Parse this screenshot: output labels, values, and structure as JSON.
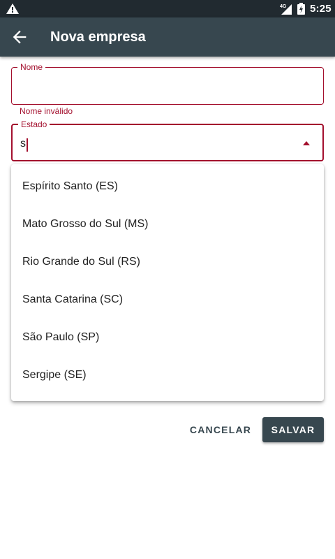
{
  "status_bar": {
    "time": "5:25",
    "network_label": "4G",
    "icons": [
      "warning-icon",
      "signal-4g-icon",
      "battery-charging-icon"
    ]
  },
  "app_bar": {
    "title": "Nova empresa",
    "back_icon": "arrow-back-icon"
  },
  "form": {
    "nome": {
      "label": "Nome",
      "value": "",
      "error": "Nome inválido"
    },
    "estado": {
      "label": "Estado",
      "value": "s",
      "dropdown_icon": "arrow-drop-up-icon"
    }
  },
  "dropdown": {
    "options": [
      "Espírito Santo (ES)",
      "Mato Grosso do Sul (MS)",
      "Rio Grande do Sul (RS)",
      "Santa Catarina (SC)",
      "São Paulo (SP)",
      "Sergipe (SE)"
    ]
  },
  "actions": {
    "cancel": "CANCELAR",
    "save": "SALVAR"
  },
  "colors": {
    "app_bar": "#37474f",
    "status_bar": "#212a30",
    "error": "#a30f2d",
    "primary_button": "#37474f"
  }
}
